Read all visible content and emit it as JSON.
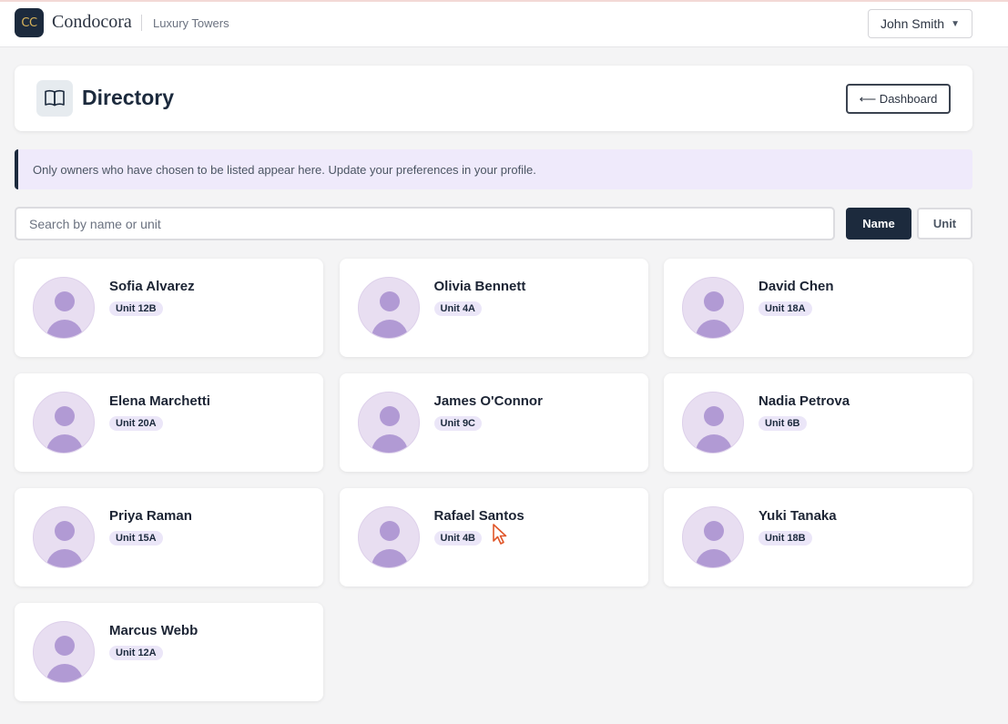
{
  "topbar": {
    "logo_text": "CC",
    "brand": "Condocora",
    "property": "Luxury Towers",
    "user_name": "John Smith",
    "user_caret": "▼"
  },
  "header": {
    "title": "Directory",
    "icon": "book-open-icon",
    "dashboard_button": "⟵ Dashboard"
  },
  "notice": {
    "text": "Only owners who have chosen to be listed appear here. Update your preferences in your profile."
  },
  "search": {
    "placeholder": "Search by name or unit",
    "value": ""
  },
  "sort": {
    "name_label": "Name",
    "unit_label": "Unit",
    "active": "Name"
  },
  "colors": {
    "navy": "#1c2a3d",
    "accent_gold": "#d9b45a",
    "avatar_bg": "#e8def1",
    "avatar_fg": "#b19ad4",
    "badge_bg": "#ebe6f8",
    "notice_bg": "#efeafb"
  },
  "owners": [
    {
      "name": "Sofia Alvarez",
      "unit": "Unit 12B"
    },
    {
      "name": "Olivia Bennett",
      "unit": "Unit 4A"
    },
    {
      "name": "David Chen",
      "unit": "Unit 18A"
    },
    {
      "name": "Elena Marchetti",
      "unit": "Unit 20A"
    },
    {
      "name": "James O'Connor",
      "unit": "Unit 9C"
    },
    {
      "name": "Nadia Petrova",
      "unit": "Unit 6B"
    },
    {
      "name": "Priya Raman",
      "unit": "Unit 15A"
    },
    {
      "name": "Rafael Santos",
      "unit": "Unit 4B"
    },
    {
      "name": "Yuki Tanaka",
      "unit": "Unit 18B"
    },
    {
      "name": "Marcus Webb",
      "unit": "Unit 12A"
    }
  ]
}
